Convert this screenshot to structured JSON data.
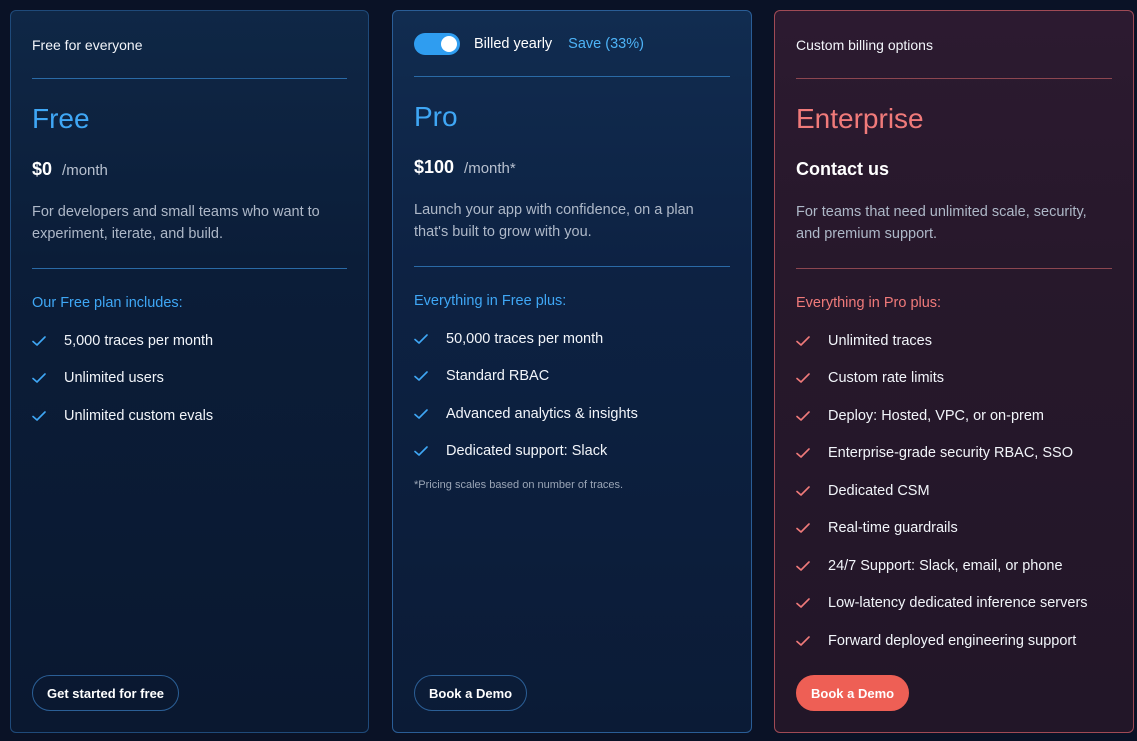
{
  "colors": {
    "accent_blue": "#3fa7f5",
    "accent_red": "#f07a7a",
    "button_red": "#ee5f55"
  },
  "free": {
    "topline": "Free for everyone",
    "name": "Free",
    "price": "$0",
    "per": "/month",
    "description": "For developers and small teams who want to experiment, iterate, and build.",
    "includes": "Our Free plan includes:",
    "features": [
      "5,000 traces per month",
      "Unlimited users",
      "Unlimited custom evals"
    ],
    "button": "Get started for free"
  },
  "pro": {
    "toggle_on": true,
    "billed": "Billed yearly",
    "save": "Save (33%)",
    "name": "Pro",
    "price": "$100",
    "per": "/month*",
    "description": "Launch your app with confidence, on a plan that's built to grow with you.",
    "includes": "Everything in Free plus:",
    "features": [
      "50,000 traces per month",
      "Standard RBAC",
      "Advanced analytics & insights",
      "Dedicated support: Slack"
    ],
    "footnote": "*Pricing scales based on number of traces.",
    "button": "Book a Demo"
  },
  "enterprise": {
    "topline": "Custom billing options",
    "name": "Enterprise",
    "price": "Contact us",
    "description": "For teams that need unlimited scale, security, and premium support.",
    "includes": "Everything in Pro plus:",
    "features": [
      "Unlimited traces",
      "Custom rate limits",
      "Deploy: Hosted, VPC, or on-prem",
      "Enterprise-grade security RBAC, SSO",
      "Dedicated CSM",
      "Real-time guardrails",
      "24/7 Support: Slack, email, or phone",
      "Low-latency dedicated inference servers",
      "Forward deployed engineering support"
    ],
    "button": "Book a Demo"
  }
}
